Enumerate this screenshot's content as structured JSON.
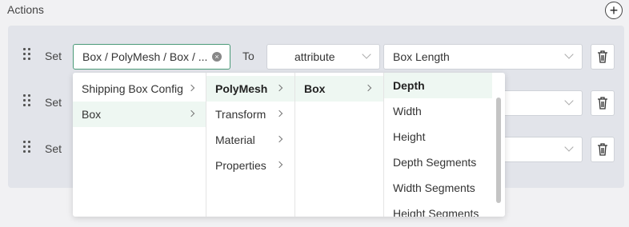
{
  "header": {
    "title": "Actions",
    "add_label": "+"
  },
  "rows": [
    {
      "set_label": "Set",
      "path_value": "Box / PolyMesh / Box / ...",
      "to_label": "To",
      "type_value": "attribute",
      "attr_value": "Box Length"
    },
    {
      "set_label": "Set"
    },
    {
      "set_label": "Set"
    }
  ],
  "cascade": {
    "col1": [
      "Shipping Box Config",
      "Box"
    ],
    "col2": [
      "PolyMesh",
      "Transform",
      "Material",
      "Properties"
    ],
    "col3": [
      "Box"
    ],
    "col4": [
      "Depth",
      "Width",
      "Height",
      "Depth Segments",
      "Width Segments",
      "Height Segments"
    ]
  },
  "colors": {
    "accent": "#4a9a78",
    "highlight": "#eef7f2",
    "panel": "#e2e4ea"
  }
}
